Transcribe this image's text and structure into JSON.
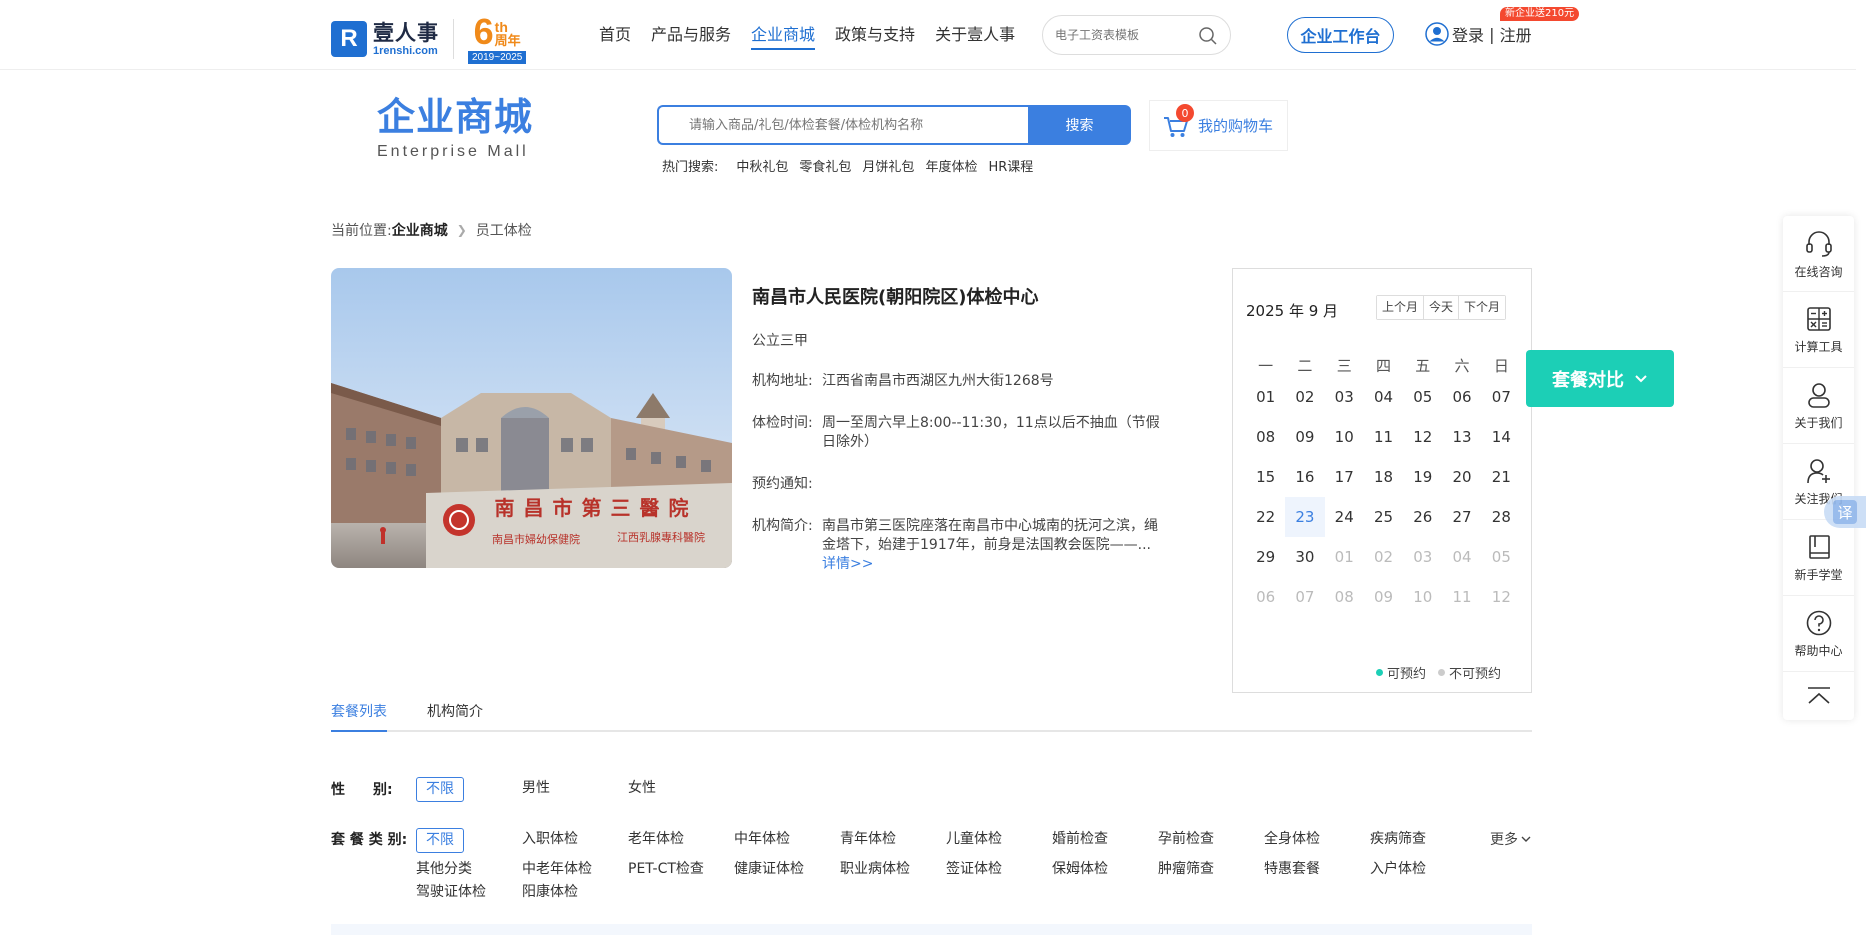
{
  "topnav": {
    "logo_cn": "壹人事",
    "logo_en": "1renshi.com",
    "anniversary_num": "6",
    "anniversary_th": "th",
    "anniversary_label": "周年",
    "anniversary_years": "2019~2025",
    "links": [
      "首页",
      "产品与服务",
      "企业商城",
      "政策与支持",
      "关于壹人事"
    ],
    "active_link": "企业商城",
    "search_placeholder": "电子工资表模板",
    "workbench": "企业工作台",
    "login": "登录",
    "separator": " | ",
    "register": "注册",
    "promo": "新企业送210元"
  },
  "mall": {
    "title_cn": "企业商城",
    "title_en": "Enterprise Mall",
    "search_placeholder": "请输入商品/礼包/体检套餐/体检机构名称",
    "search_button": "搜索",
    "hot_label": "热门搜索:",
    "hot_items": [
      "中秋礼包",
      "零食礼包",
      "月饼礼包",
      "年度体检",
      "HR课程"
    ],
    "cart_label": "我的购物车",
    "cart_count": "0"
  },
  "breadcrumb": {
    "prefix": "当前位置:",
    "mall": "企业商城",
    "current": "员工体检"
  },
  "hospital": {
    "name": "南昌市人民医院(朝阳院区)体检中心",
    "grade": "公立三甲",
    "address_label": "机构地址:",
    "address": "江西省南昌市西湖区九州大街1268号",
    "hours_label": "体检时间:",
    "hours": "周一至周六早上8:00--11:30，11点以后不抽血（节假日除外）",
    "notice_label": "预约通知:",
    "notice": "",
    "intro_label": "机构简介:",
    "intro": "南昌市第三医院座落在南昌市中心城南的抚河之滨，绳金塔下，始建于1917年，前身是法国教会医院——...",
    "detail_link": "详情>>",
    "photo_sign_main": "南昌市第三醫院",
    "photo_sign_sub1": "南昌市婦幼保健院",
    "photo_sign_sub2": "江西乳腺專科醫院"
  },
  "calendar": {
    "title": "2025 年 9 月",
    "buttons": [
      "上个月",
      "今天",
      "下个月"
    ],
    "weekdays": [
      "一",
      "二",
      "三",
      "四",
      "五",
      "六",
      "日"
    ],
    "weeks": [
      [
        "01",
        "02",
        "03",
        "04",
        "05",
        "06",
        "07"
      ],
      [
        "08",
        "09",
        "10",
        "11",
        "12",
        "13",
        "14"
      ],
      [
        "15",
        "16",
        "17",
        "18",
        "19",
        "20",
        "21"
      ],
      [
        "22",
        "23",
        "24",
        "25",
        "26",
        "27",
        "28"
      ],
      [
        "29",
        "30",
        "01",
        "02",
        "03",
        "04",
        "05"
      ],
      [
        "06",
        "07",
        "08",
        "09",
        "10",
        "11",
        "12"
      ]
    ],
    "today": "23",
    "legend_available": "可预约",
    "legend_unavailable": "不可预约",
    "available_color": "#1ccfb6",
    "unavailable_color": "#cccccc"
  },
  "compare_button": "套餐对比",
  "rightbar": {
    "items": [
      "在线咨询",
      "计算工具",
      "关于我们",
      "关注我们",
      "新手学堂",
      "帮助中心"
    ],
    "translate": "译"
  },
  "tabs": [
    "套餐列表",
    "机构简介"
  ],
  "filters": {
    "gender_label": "性　　别:",
    "gender_options": [
      "不限",
      "男性",
      "女性"
    ],
    "package_label": "套 餐 类 别:",
    "package_options_row1": [
      "不限",
      "入职体检",
      "老年体检",
      "中年体检",
      "青年体检",
      "儿童体检",
      "婚前检查",
      "孕前检查",
      "全身体检",
      "疾病筛查"
    ],
    "package_options_row2": [
      "其他分类",
      "中老年体检",
      "PET-CT检查",
      "健康证体检",
      "职业病体检",
      "签证体检",
      "保姆体检",
      "肿瘤筛查",
      "特惠套餐",
      "入户体检"
    ],
    "package_options_row3": [
      "驾驶证体检",
      "阳康体检"
    ],
    "more": "更多"
  },
  "colors": {
    "brand": "#1f6fd1",
    "accent": "#3b7fe0",
    "teal": "#1ccfb6",
    "promo": "#f4492f",
    "anniversary": "#f08a1a"
  }
}
